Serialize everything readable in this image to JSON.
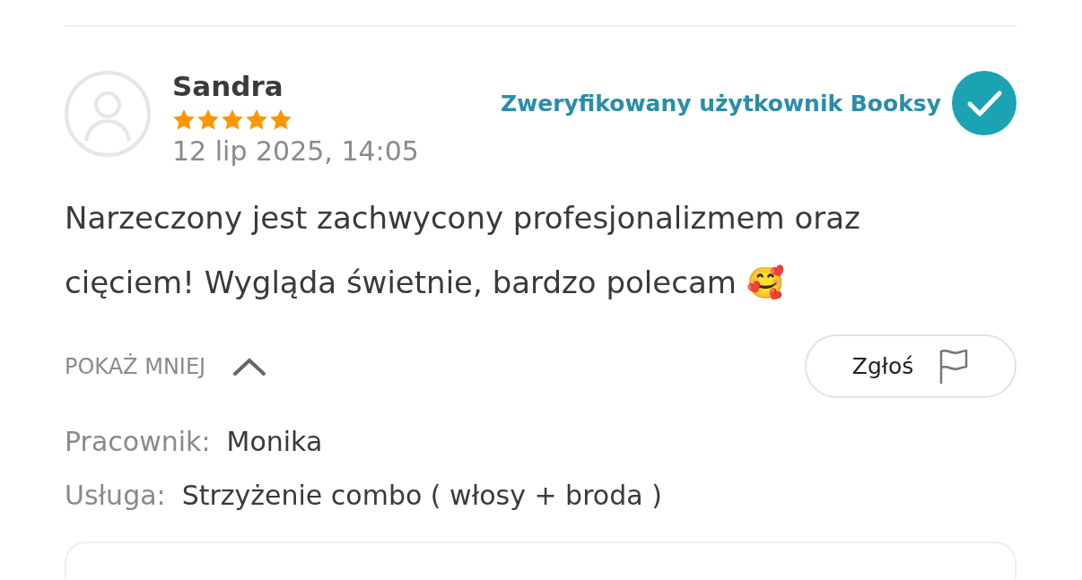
{
  "review": {
    "author": "Sandra",
    "stars": 5,
    "date": "12 lip 2025, 14:05",
    "verified_label": "Zweryfikowany użytkownik Booksy",
    "text": "Narzeczony jest zachwycony profesjonalizmem oraz cięciem! Wygląda świetnie, bardzo polecam 🥰",
    "toggle": {
      "label": "POKAŻ MNIEJ",
      "expanded": true
    },
    "report_button": "Zgłoś",
    "details": [
      {
        "label": "Pracownik:",
        "value": "Monika"
      },
      {
        "label": "Usługa:",
        "value": "Strzyżenie combo ( włosy + broda )"
      }
    ]
  }
}
